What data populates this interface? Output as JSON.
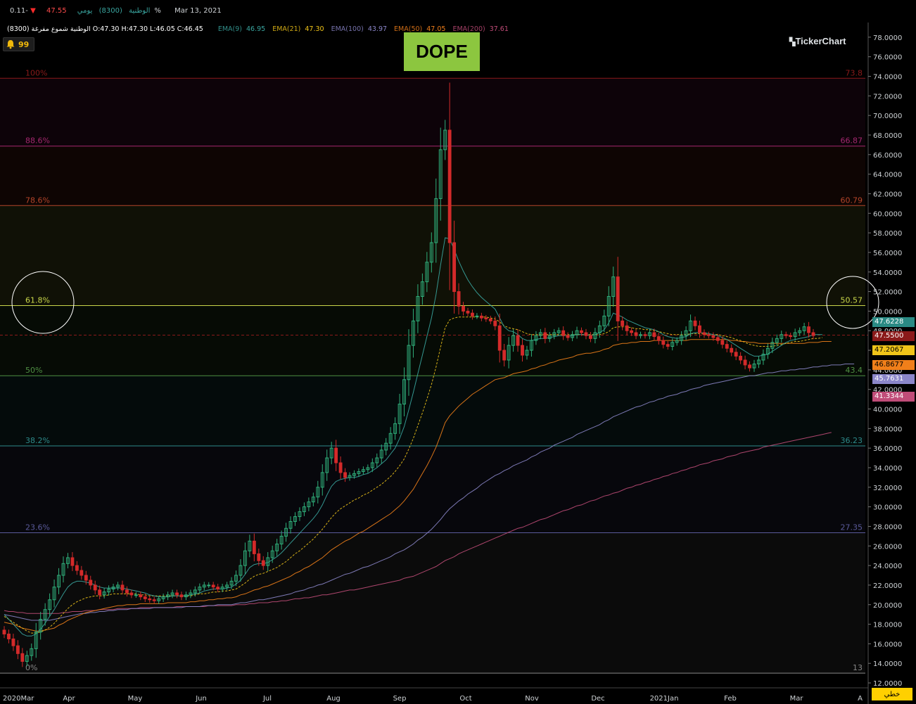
{
  "header": {
    "line1": {
      "symbol_name": "الوطنية",
      "symbol_code": "(8300)",
      "period": "يومي",
      "last_price": "47.55",
      "change_pct": "-0.11%",
      "date": "Mar 13, 2021"
    },
    "line2": {
      "ohlc_label": "الوطنية شموع مفرغة (8300) O:47.30 H:47.30 L:46.05 C:46.45",
      "ema": [
        {
          "label": "EMA(9)",
          "value": "46.95",
          "color": "#3aa6a0"
        },
        {
          "label": "EMA(21)",
          "value": "47.30",
          "color": "#f0c419"
        },
        {
          "label": "EMA(100)",
          "value": "43.97",
          "color": "#8b86c9"
        },
        {
          "label": "EMA(50)",
          "value": "47.05",
          "color": "#f07f1a"
        },
        {
          "label": "EMA(200)",
          "value": "37.61",
          "color": "#c04c78"
        }
      ]
    }
  },
  "alerts": {
    "count": "99",
    "icon": "bell-icon"
  },
  "annotation": {
    "label": "DOPE"
  },
  "brand": {
    "name": "TickerChart"
  },
  "bottom_button": {
    "label": "خطي"
  },
  "chart_data": {
    "type": "candlestick",
    "x_labels": [
      "2020Mar",
      "Apr",
      "May",
      "Jun",
      "Jul",
      "Aug",
      "Sep",
      "Oct",
      "Nov",
      "Dec",
      "2021Jan",
      "Feb",
      "Mar",
      "A"
    ],
    "y_ticks": [
      "78.0000",
      "76.0000",
      "74.0000",
      "72.0000",
      "70.0000",
      "68.0000",
      "66.0000",
      "64.0000",
      "62.0000",
      "60.0000",
      "58.0000",
      "56.0000",
      "54.0000",
      "52.0000",
      "50.0000",
      "48.0000",
      "46.0000",
      "44.0000",
      "42.0000",
      "40.0000",
      "38.0000",
      "36.0000",
      "34.0000",
      "32.0000",
      "30.0000",
      "28.0000",
      "26.0000",
      "24.0000",
      "22.0000",
      "20.0000",
      "18.0000",
      "16.0000",
      "14.0000",
      "12.0000"
    ],
    "ylim": [
      11.5,
      79.5
    ],
    "fibonacci": [
      {
        "pct": "100%",
        "value": "73.8",
        "color": "#8b1a1a"
      },
      {
        "pct": "88.6%",
        "value": "66.87",
        "color": "#a3286e"
      },
      {
        "pct": "78.6%",
        "value": "60.79",
        "color": "#b4452a"
      },
      {
        "pct": "61.8%",
        "value": "50.57",
        "color": "#c9d64a"
      },
      {
        "pct": "50%",
        "value": "43.4",
        "color": "#4f8f43"
      },
      {
        "pct": "38.2%",
        "value": "36.23",
        "color": "#2e8b8b"
      },
      {
        "pct": "23.6%",
        "value": "27.35",
        "color": "#5a5a9a"
      },
      {
        "pct": "0%",
        "value": "13",
        "color": "#888888"
      }
    ],
    "price_labels": [
      {
        "value": "47.6228",
        "bg": "#2a8a84"
      },
      {
        "value": "47.5500",
        "bg": "#8b1a1a"
      },
      {
        "value": "47.2067",
        "bg": "#f0c419"
      },
      {
        "value": "46.8677",
        "bg": "#f07f1a"
      },
      {
        "value": "45.7631",
        "bg": "#8b86c9"
      },
      {
        "value": "41.3344",
        "bg": "#c04c78"
      }
    ],
    "last_price_line": 47.55,
    "closes": [
      17.0,
      16.5,
      15.8,
      15.0,
      14.2,
      14.8,
      15.5,
      17.2,
      18.5,
      19.5,
      20.5,
      21.8,
      23.0,
      24.2,
      24.8,
      24.0,
      23.5,
      23.0,
      22.5,
      22.0,
      21.5,
      21.0,
      21.3,
      21.6,
      21.8,
      22.0,
      21.5,
      21.2,
      21.0,
      21.0,
      20.8,
      20.6,
      20.5,
      20.4,
      20.6,
      20.8,
      21.0,
      21.2,
      21.0,
      20.8,
      21.0,
      21.2,
      21.5,
      21.8,
      22.0,
      22.0,
      21.8,
      21.6,
      21.8,
      22.0,
      22.4,
      23.0,
      24.0,
      25.5,
      26.5,
      25.2,
      24.5,
      24.0,
      24.8,
      25.5,
      26.2,
      27.0,
      27.8,
      28.5,
      29.0,
      29.5,
      30.0,
      30.5,
      31.0,
      32.0,
      33.5,
      35.0,
      36.0,
      34.5,
      33.5,
      33.0,
      33.2,
      33.4,
      33.6,
      33.8,
      34.0,
      34.5,
      35.0,
      35.8,
      36.5,
      37.5,
      38.5,
      40.5,
      43.0,
      46.5,
      49.0,
      51.5,
      53.0,
      55.0,
      57.0,
      61.5,
      66.5,
      68.5,
      57.0,
      52.0,
      50.5,
      50.0,
      49.8,
      49.5,
      49.5,
      49.3,
      49.2,
      49.0,
      48.5,
      46.0,
      45.0,
      46.5,
      47.5,
      46.5,
      45.5,
      46.0,
      47.0,
      47.5,
      47.8,
      47.2,
      47.5,
      47.8,
      48.0,
      47.5,
      47.3,
      47.6,
      48.0,
      47.8,
      47.5,
      47.2,
      47.8,
      48.5,
      49.5,
      51.5,
      53.5,
      49.0,
      48.5,
      48.0,
      47.8,
      47.5,
      47.6,
      47.5,
      47.8,
      47.4,
      47.0,
      46.6,
      46.4,
      46.8,
      47.0,
      47.5,
      48.0,
      49.0,
      48.5,
      47.8,
      47.6,
      47.5,
      47.3,
      47.0,
      46.6,
      46.2,
      45.8,
      45.4,
      45.0,
      44.5,
      44.2,
      44.6,
      45.0,
      45.6,
      46.2,
      46.8,
      47.2,
      47.6,
      47.5,
      47.4,
      47.8,
      48.0,
      48.4,
      47.8,
      47.5
    ],
    "ema9": [
      19.0,
      18.5,
      18.0,
      17.5,
      17.0,
      16.8,
      16.8,
      17.0,
      17.5,
      18.1,
      18.8,
      19.5,
      20.3,
      21.1,
      21.8,
      22.2,
      22.4,
      22.4,
      22.3,
      22.2,
      22.0,
      21.8,
      21.7,
      21.7,
      21.7,
      21.7,
      21.7,
      21.6,
      21.5,
      21.4,
      21.3,
      21.2,
      21.0,
      20.9,
      20.8,
      20.8,
      20.8,
      20.9,
      20.9,
      20.9,
      20.9,
      21.0,
      21.1,
      21.2,
      21.4,
      21.5,
      21.6,
      21.6,
      21.6,
      21.7,
      21.8,
      22.1,
      22.5,
      23.1,
      23.8,
      24.1,
      24.2,
      24.2,
      24.3,
      24.6,
      24.9,
      25.3,
      25.8,
      26.3,
      26.8,
      27.3,
      27.8,
      28.3,
      28.8,
      29.4,
      30.2,
      31.2,
      32.1,
      32.6,
      32.8,
      32.9,
      33.0,
      33.0,
      33.1,
      33.3,
      33.4,
      33.7,
      34.0,
      34.4,
      34.8,
      35.4,
      36.0,
      37.0,
      38.2,
      39.9,
      41.7,
      43.6,
      45.5,
      47.4,
      49.3,
      51.7,
      54.7,
      57.5,
      57.4,
      56.3,
      55.1,
      54.1,
      53.2,
      52.5,
      51.9,
      51.4,
      51.0,
      50.6,
      50.2,
      49.3,
      48.4,
      48.0,
      47.9,
      47.6,
      47.2,
      47.0,
      47.0,
      47.1,
      47.2,
      47.2,
      47.3,
      47.4,
      47.5,
      47.5,
      47.5,
      47.5,
      47.6,
      47.6,
      47.6,
      47.5,
      47.6,
      47.8,
      48.1,
      48.8,
      49.8,
      49.6,
      49.4,
      49.1,
      48.9,
      48.7,
      48.5,
      48.3,
      48.2,
      48.1,
      47.9,
      47.6,
      47.4,
      47.3,
      47.2,
      47.3,
      47.4,
      47.7,
      47.8,
      47.8,
      47.8,
      47.7,
      47.6,
      47.5,
      47.3,
      47.1,
      46.8,
      46.5,
      46.2,
      45.9,
      45.6,
      45.4,
      45.4,
      45.5,
      45.6,
      45.9,
      46.2,
      46.5,
      46.8,
      47.0,
      47.1,
      47.2,
      47.3,
      47.4,
      47.6,
      47.6,
      47.6
    ],
    "ema21": [
      18.8,
      18.5,
      18.2,
      17.9,
      17.6,
      17.3,
      17.1,
      17.1,
      17.2,
      17.4,
      17.7,
      18.1,
      18.6,
      19.1,
      19.6,
      20.0,
      20.3,
      20.5,
      20.7,
      20.8,
      20.9,
      20.9,
      20.9,
      21.0,
      21.1,
      21.1,
      21.1,
      21.1,
      21.1,
      21.1,
      21.0,
      21.0,
      20.9,
      20.9,
      20.9,
      20.9,
      20.9,
      20.9,
      20.9,
      20.9,
      20.9,
      20.9,
      21.0,
      21.1,
      21.1,
      21.2,
      21.3,
      21.3,
      21.4,
      21.4,
      21.5,
      21.6,
      21.9,
      22.2,
      22.6,
      22.9,
      23.1,
      23.2,
      23.4,
      23.6,
      23.8,
      24.1,
      24.4,
      24.8,
      25.2,
      25.5,
      25.9,
      26.3,
      26.7,
      27.2,
      27.7,
      28.3,
      28.9,
      29.4,
      29.8,
      30.1,
      30.4,
      30.7,
      30.9,
      31.2,
      31.4,
      31.7,
      32.0,
      32.3,
      32.7,
      33.1,
      33.6,
      34.2,
      34.9,
      35.9,
      37.0,
      38.3,
      39.6,
      41.0,
      42.5,
      44.3,
      46.3,
      48.3,
      49.1,
      49.3,
      49.4,
      49.4,
      49.4,
      49.4,
      49.4,
      49.4,
      49.4,
      49.3,
      49.2,
      48.9,
      48.5,
      48.3,
      48.2,
      48.1,
      47.9,
      47.7,
      47.6,
      47.6,
      47.6,
      47.6,
      47.6,
      47.6,
      47.6,
      47.6,
      47.6,
      47.6,
      47.6,
      47.6,
      47.6,
      47.6,
      47.6,
      47.6,
      47.7,
      47.9,
      48.3,
      48.4,
      48.4,
      48.4,
      48.3,
      48.2,
      48.2,
      48.1,
      48.1,
      48.0,
      47.9,
      47.8,
      47.7,
      47.6,
      47.6,
      47.6,
      47.6,
      47.7,
      47.7,
      47.7,
      47.7,
      47.6,
      47.6,
      47.6,
      47.5,
      47.4,
      47.3,
      47.1,
      47.0,
      46.8,
      46.6,
      46.5,
      46.4,
      46.4,
      46.4,
      46.4,
      46.5,
      46.6,
      46.7,
      46.8,
      46.9,
      46.9,
      47.0,
      47.1,
      47.2,
      47.2,
      47.3
    ],
    "ema50": [
      18.2,
      18.1,
      18.0,
      17.8,
      17.6,
      17.5,
      17.4,
      17.3,
      17.3,
      17.4,
      17.5,
      17.6,
      17.9,
      18.1,
      18.4,
      18.6,
      18.8,
      19.0,
      19.2,
      19.3,
      19.4,
      19.5,
      19.6,
      19.7,
      19.8,
      19.9,
      19.9,
      20.0,
      20.0,
      20.0,
      20.1,
      20.1,
      20.1,
      20.1,
      20.1,
      20.1,
      20.2,
      20.2,
      20.2,
      20.2,
      20.2,
      20.3,
      20.3,
      20.4,
      20.4,
      20.5,
      20.5,
      20.6,
      20.6,
      20.7,
      20.7,
      20.8,
      21.0,
      21.1,
      21.3,
      21.5,
      21.6,
      21.8,
      21.9,
      22.1,
      22.3,
      22.5,
      22.7,
      22.9,
      23.2,
      23.4,
      23.7,
      23.9,
      24.2,
      24.5,
      24.8,
      25.2,
      25.6,
      25.9,
      26.2,
      26.5,
      26.7,
      27.0,
      27.3,
      27.5,
      27.8,
      28.1,
      28.4,
      28.7,
      29.0,
      29.3,
      29.7,
      30.1,
      30.6,
      31.2,
      31.8,
      32.6,
      33.4,
      34.2,
      35.1,
      36.1,
      37.3,
      38.6,
      39.3,
      39.8,
      40.3,
      40.7,
      41.1,
      41.5,
      41.8,
      42.1,
      42.4,
      42.7,
      43.0,
      43.1,
      43.2,
      43.4,
      43.6,
      43.7,
      43.8,
      43.9,
      44.1,
      44.2,
      44.4,
      44.5,
      44.7,
      44.8,
      45.0,
      45.1,
      45.2,
      45.3,
      45.5,
      45.6,
      45.7,
      45.7,
      45.8,
      45.9,
      46.1,
      46.2,
      46.5,
      46.6,
      46.7,
      46.7,
      46.8,
      46.8,
      46.9,
      46.9,
      46.9,
      47.0,
      47.0,
      47.0,
      47.0,
      47.0,
      47.0,
      47.0,
      47.0,
      47.1,
      47.1,
      47.1,
      47.1,
      47.1,
      47.1,
      47.1,
      47.1,
      47.1,
      47.0,
      47.0,
      46.9,
      46.9,
      46.8,
      46.8,
      46.7,
      46.7,
      46.7,
      46.7,
      46.7,
      46.7,
      46.7,
      46.7,
      46.7,
      46.7,
      46.7,
      46.8,
      46.8,
      46.8,
      46.9,
      46.9,
      46.9
    ],
    "ema100": [
      19.0,
      18.9,
      18.8,
      18.7,
      18.6,
      18.5,
      18.4,
      18.4,
      18.4,
      18.4,
      18.4,
      18.5,
      18.6,
      18.7,
      18.8,
      18.9,
      19.0,
      19.1,
      19.1,
      19.2,
      19.2,
      19.3,
      19.3,
      19.4,
      19.4,
      19.5,
      19.5,
      19.5,
      19.6,
      19.6,
      19.6,
      19.6,
      19.6,
      19.7,
      19.7,
      19.7,
      19.7,
      19.7,
      19.7,
      19.7,
      19.8,
      19.8,
      19.8,
      19.8,
      19.9,
      19.9,
      19.9,
      20.0,
      20.0,
      20.0,
      20.0,
      20.1,
      20.2,
      20.2,
      20.3,
      20.4,
      20.5,
      20.5,
      20.6,
      20.7,
      20.8,
      20.9,
      21.0,
      21.1,
      21.3,
      21.4,
      21.5,
      21.7,
      21.8,
      22.0,
      22.1,
      22.3,
      22.5,
      22.7,
      22.9,
      23.1,
      23.2,
      23.4,
      23.6,
      23.8,
      23.9,
      24.1,
      24.3,
      24.5,
      24.7,
      24.9,
      25.2,
      25.4,
      25.6,
      25.9,
      26.2,
      26.6,
      26.9,
      27.3,
      27.7,
      28.2,
      28.7,
      29.3,
      29.8,
      30.2,
      30.6,
      30.9,
      31.3,
      31.6,
      31.9,
      32.3,
      32.6,
      32.9,
      33.2,
      33.4,
      33.7,
      33.9,
      34.2,
      34.4,
      34.6,
      34.8,
      35.1,
      35.3,
      35.6,
      35.8,
      36.0,
      36.3,
      36.5,
      36.7,
      36.9,
      37.1,
      37.4,
      37.6,
      37.8,
      38.0,
      38.2,
      38.4,
      38.7,
      38.9,
      39.2,
      39.4,
      39.6,
      39.8,
      40.0,
      40.2,
      40.3,
      40.5,
      40.7,
      40.8,
      41.0,
      41.1,
      41.3,
      41.4,
      41.5,
      41.7,
      41.8,
      42.0,
      42.1,
      42.2,
      42.4,
      42.5,
      42.6,
      42.7,
      42.8,
      42.9,
      43.0,
      43.1,
      43.2,
      43.3,
      43.4,
      43.4,
      43.5,
      43.6,
      43.7,
      43.7,
      43.8,
      43.9,
      43.9,
      44.0,
      44.0,
      44.1,
      44.1,
      44.2,
      44.3,
      44.3,
      44.4,
      44.4,
      44.5,
      44.5,
      44.5,
      44.6,
      44.6,
      44.6
    ],
    "ema200": [
      19.4,
      19.3,
      19.3,
      19.2,
      19.2,
      19.1,
      19.1,
      19.1,
      19.1,
      19.1,
      19.1,
      19.1,
      19.1,
      19.2,
      19.2,
      19.3,
      19.3,
      19.3,
      19.4,
      19.4,
      19.4,
      19.5,
      19.5,
      19.5,
      19.5,
      19.6,
      19.6,
      19.6,
      19.6,
      19.6,
      19.7,
      19.7,
      19.7,
      19.7,
      19.7,
      19.7,
      19.7,
      19.7,
      19.8,
      19.8,
      19.8,
      19.8,
      19.8,
      19.8,
      19.8,
      19.9,
      19.9,
      19.9,
      19.9,
      19.9,
      19.9,
      20.0,
      20.0,
      20.0,
      20.1,
      20.1,
      20.2,
      20.2,
      20.2,
      20.3,
      20.3,
      20.4,
      20.4,
      20.5,
      20.6,
      20.6,
      20.7,
      20.7,
      20.8,
      20.9,
      21.0,
      21.0,
      21.1,
      21.2,
      21.3,
      21.4,
      21.5,
      21.5,
      21.6,
      21.7,
      21.8,
      21.9,
      22.0,
      22.1,
      22.2,
      22.3,
      22.4,
      22.5,
      22.7,
      22.8,
      22.9,
      23.1,
      23.3,
      23.5,
      23.7,
      23.9,
      24.2,
      24.5,
      24.7,
      24.9,
      25.2,
      25.4,
      25.6,
      25.8,
      26.0,
      26.2,
      26.4,
      26.6,
      26.8,
      27.0,
      27.2,
      27.4,
      27.6,
      27.8,
      27.9,
      28.1,
      28.3,
      28.5,
      28.7,
      28.8,
      29.0,
      29.2,
      29.4,
      29.6,
      29.7,
      29.9,
      30.1,
      30.2,
      30.4,
      30.6,
      30.7,
      30.9,
      31.1,
      31.2,
      31.4,
      31.5,
      31.7,
      31.9,
      32.0,
      32.2,
      32.3,
      32.5,
      32.6,
      32.8,
      32.9,
      33.1,
      33.2,
      33.4,
      33.5,
      33.7,
      33.8,
      34.0,
      34.1,
      34.3,
      34.4,
      34.5,
      34.7,
      34.8,
      34.9,
      35.1,
      35.2,
      35.3,
      35.5,
      35.6,
      35.7,
      35.8,
      35.9,
      36.1,
      36.2,
      36.3,
      36.4,
      36.5,
      36.6,
      36.7,
      36.8,
      36.9,
      37.0,
      37.1,
      37.2,
      37.3,
      37.4,
      37.5,
      37.6
    ]
  }
}
